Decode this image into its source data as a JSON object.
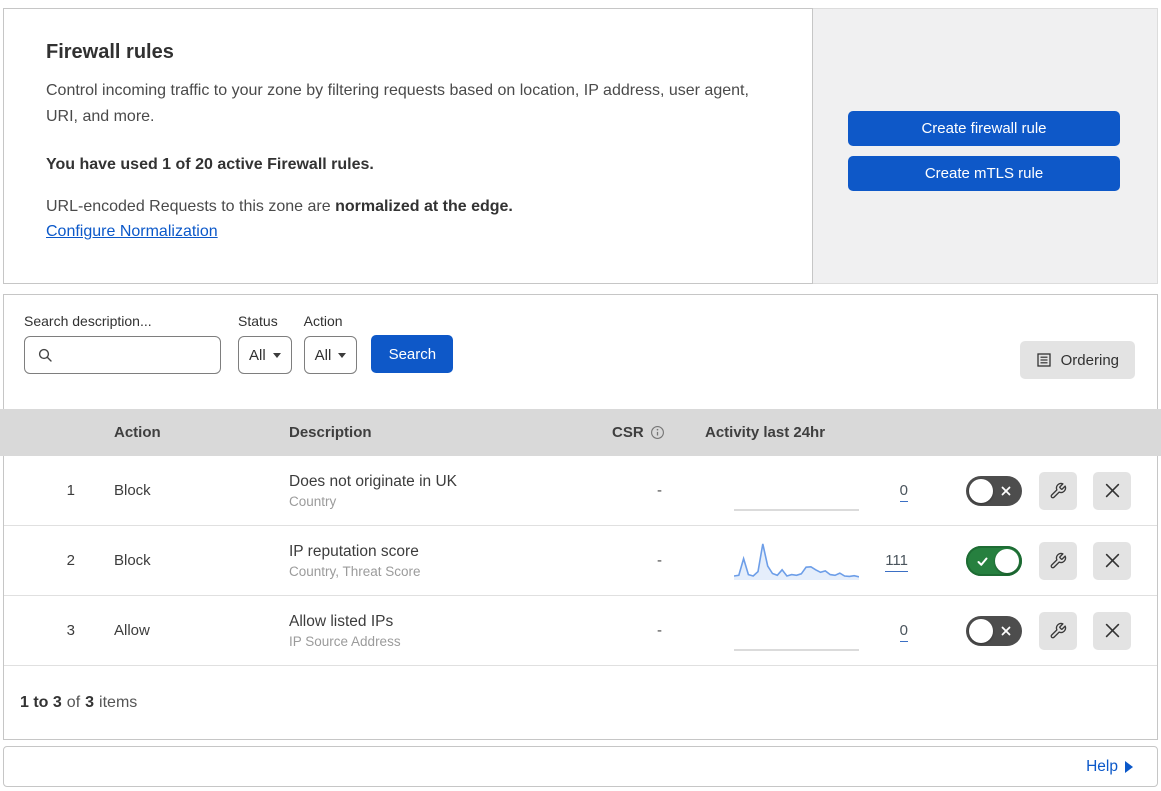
{
  "intro": {
    "title": "Firewall rules",
    "description": "Control incoming traffic to your zone by filtering requests based on location, IP address, user agent, URI, and more.",
    "usage": "You have used 1 of 20 active Firewall rules.",
    "normalization_text": "URL-encoded Requests to this zone are ",
    "normalization_bold": "normalized at the edge.",
    "configure_link": "Configure Normalization"
  },
  "actions": {
    "create_firewall_label": "Create firewall rule",
    "create_mtls_label": "Create mTLS rule"
  },
  "filters": {
    "search_label": "Search description...",
    "search_value": "",
    "status_label": "Status",
    "status_value": "All",
    "action_label": "Action",
    "action_value": "All",
    "search_button_label": "Search",
    "ordering_button_label": "Ordering"
  },
  "table": {
    "headers": {
      "action": "Action",
      "description": "Description",
      "csr": "CSR",
      "activity": "Activity last 24hr"
    },
    "rows": [
      {
        "number": "1",
        "action": "Block",
        "description": "Does not originate in UK",
        "fields": "Country",
        "csr": "-",
        "activity_count": "0",
        "enabled": false,
        "sparkline": []
      },
      {
        "number": "2",
        "action": "Block",
        "description": "IP reputation score",
        "fields": "Country, Threat Score",
        "csr": "-",
        "activity_count": "111",
        "enabled": true,
        "sparkline": [
          8,
          10,
          55,
          12,
          8,
          20,
          95,
          35,
          15,
          10,
          25,
          8,
          12,
          10,
          14,
          32,
          33,
          25,
          18,
          22,
          12,
          10,
          16,
          8,
          7,
          9,
          6
        ]
      },
      {
        "number": "3",
        "action": "Allow",
        "description": "Allow listed IPs",
        "fields": "IP Source Address",
        "csr": "-",
        "activity_count": "0",
        "enabled": false,
        "sparkline": []
      }
    ]
  },
  "footer": {
    "range": "1 to 3",
    "of": "of",
    "total": "3",
    "items": "items"
  },
  "help": {
    "label": "Help"
  },
  "icons": {
    "search": "magnifier-icon",
    "dropdown": "chevron-down-icon",
    "ordering": "list-box-icon",
    "csr_info": "info-circle-icon",
    "toggle_on": "check-icon",
    "toggle_off": "x-icon",
    "edit": "wrench-icon",
    "delete": "close-icon",
    "help": "arrow-right-icon"
  },
  "colors": {
    "primary_blue": "#0e58c8",
    "link_blue": "#0b58c9",
    "toggle_on_green": "#26803f",
    "toggle_off_gray": "#4d4d4d",
    "table_header_gray": "#d9d9d9",
    "side_panel_gray": "#f0f0f1",
    "sparkline_blue": "#6d9ee8"
  }
}
